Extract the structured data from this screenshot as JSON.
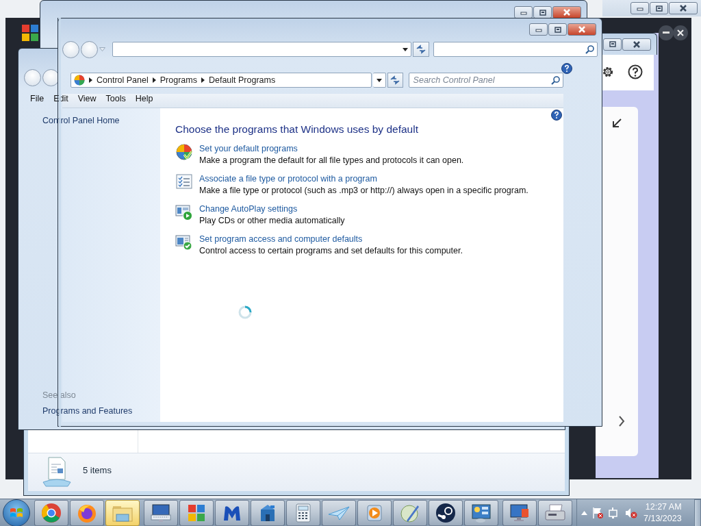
{
  "front_window": {
    "breadcrumb": [
      "Control Panel",
      "Programs",
      "Default Programs"
    ],
    "search": {
      "placeholder": "Search Control Panel"
    }
  },
  "menu": [
    "File",
    "Edit",
    "View",
    "Tools",
    "Help"
  ],
  "left_pane": {
    "home_link": "Control Panel Home",
    "see_also_heading": "See also",
    "see_also_links": [
      "Programs and Features"
    ]
  },
  "content": {
    "heading": "Choose the programs that Windows uses by default",
    "tasks": [
      {
        "kind": "defaults",
        "title": "Set your default programs",
        "description": "Make a program the default for all file types and protocols it can open."
      },
      {
        "kind": "associate",
        "title": "Associate a file type or protocol with a program",
        "description": "Make a file type or protocol (such as .mp3 or http://) always open in a specific program."
      },
      {
        "kind": "autoplay",
        "title": "Change AutoPlay settings",
        "description": "Play CDs or other media automatically"
      },
      {
        "kind": "access",
        "title": "Set program access and computer defaults",
        "description": "Control access to certain programs and set defaults for this computer."
      }
    ]
  },
  "background_window": {
    "status": "5 items"
  },
  "taskbar": {
    "apps": [
      {
        "kind": "chrome",
        "selected": false
      },
      {
        "kind": "firefox",
        "selected": false
      },
      {
        "kind": "folder",
        "selected": true
      },
      {
        "kind": "keyboard",
        "selected": false
      },
      {
        "kind": "squares",
        "selected": false
      },
      {
        "kind": "mlogo",
        "selected": false
      },
      {
        "kind": "building",
        "selected": false
      },
      {
        "kind": "calculator",
        "selected": false
      },
      {
        "kind": "plane",
        "selected": false
      },
      {
        "kind": "media",
        "selected": false
      },
      {
        "kind": "pen",
        "selected": false
      },
      {
        "kind": "steam",
        "selected": false
      },
      {
        "kind": "panel",
        "selected": false
      },
      {
        "kind": "monitor",
        "selected": false
      },
      {
        "kind": "printer",
        "selected": false
      }
    ],
    "clock": {
      "time": "12:27 AM",
      "date": "7/13/2023"
    }
  }
}
